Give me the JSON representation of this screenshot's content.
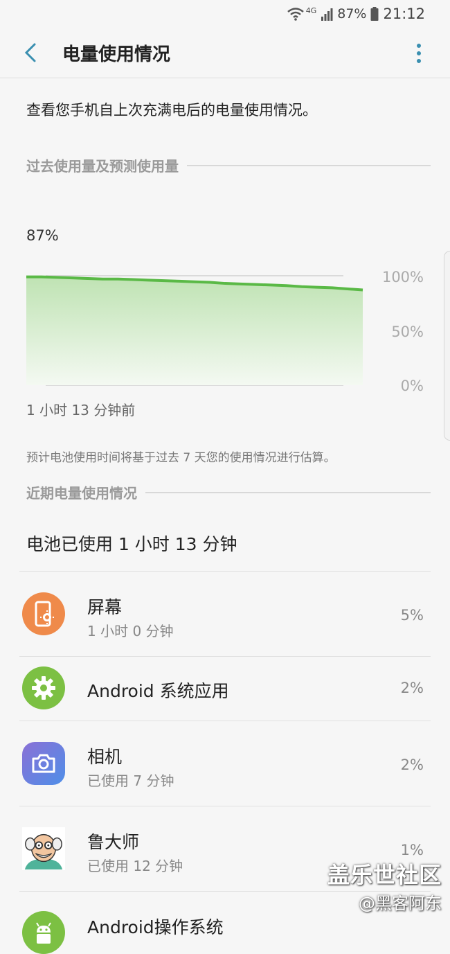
{
  "status_bar": {
    "network": "4G",
    "battery": "87%",
    "time": "21:12"
  },
  "app_bar": {
    "title": "电量使用情况"
  },
  "intro": "查看您手机自上次充满电后的电量使用情况。",
  "history_section": {
    "heading": "过去使用量及预测使用量",
    "current_percent": "87%",
    "y_labels": [
      "100%",
      "50%",
      "0%"
    ],
    "start_label": "1 小时 13 分钟前",
    "estimate_note": "预计电池使用时间将基于过去 7 天您的使用情况进行估算。"
  },
  "chart_data": {
    "type": "area",
    "title": "",
    "xlabel": "",
    "ylabel": "",
    "ylim": [
      0,
      100
    ],
    "x_start_label": "1 小时 13 分钟前",
    "ytick_labels": [
      "100%",
      "50%",
      "0%"
    ],
    "series": [
      {
        "color": "#5ab946",
        "values": [
          99,
          99,
          98.5,
          98,
          97.5,
          97,
          97,
          96.5,
          96,
          95.5,
          95,
          94.5,
          94,
          93,
          92.5,
          92,
          91.5,
          91,
          90,
          89.5,
          89,
          88,
          87
        ]
      }
    ]
  },
  "recent_section": {
    "heading": "近期电量使用情况",
    "used_summary": "电池已使用 1 小时 13 分钟"
  },
  "usage_items": [
    {
      "name": "屏幕",
      "sub": "1 小时 0 分钟",
      "percent": "5%",
      "icon": "screen-brightness-icon",
      "color": "#ef8a4a"
    },
    {
      "name": "Android 系统应用",
      "sub": "",
      "percent": "2%",
      "icon": "gear-icon",
      "color": "#7cc043"
    },
    {
      "name": "相机",
      "sub": "已使用 7 分钟",
      "percent": "2%",
      "icon": "camera-icon",
      "color": "#6a7fe0"
    },
    {
      "name": "鲁大师",
      "sub": "已使用 12 分钟",
      "percent": "1%",
      "icon": "ludashi-avatar-icon",
      "color": "#ffffff"
    },
    {
      "name": "Android操作系统",
      "sub": "",
      "percent": "",
      "icon": "android-icon",
      "color": "#7cc043"
    }
  ],
  "watermark": {
    "line1": "盖乐世社区",
    "line2": "@黑客阿东"
  }
}
